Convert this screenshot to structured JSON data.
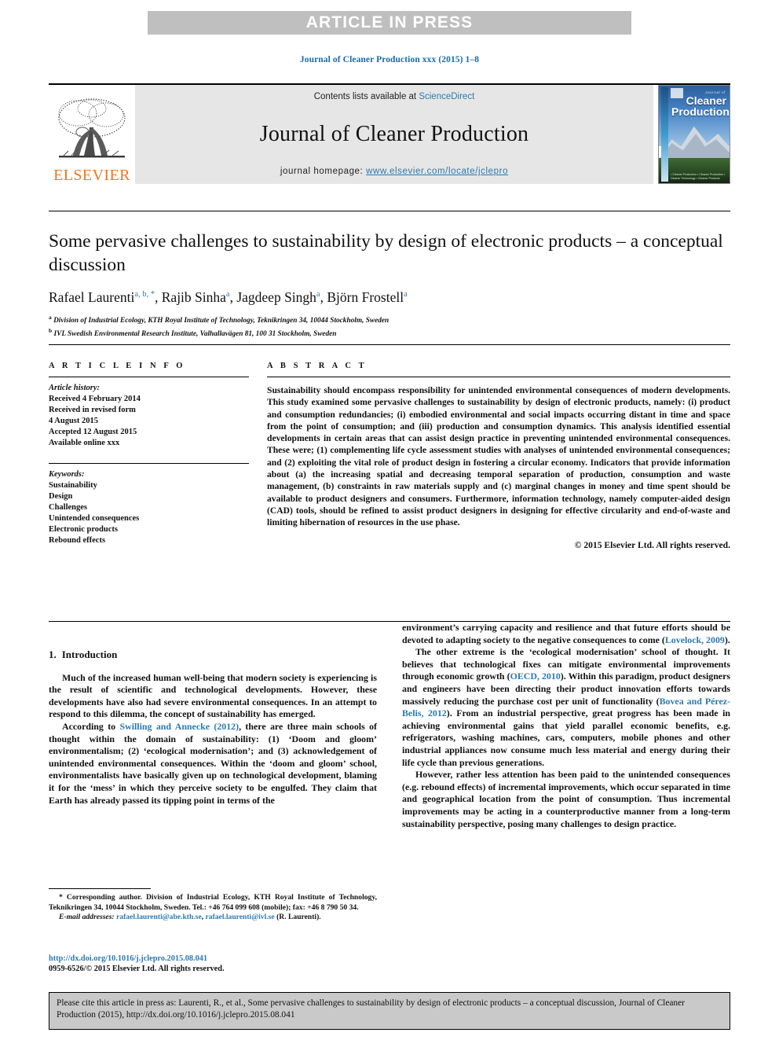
{
  "banner": {
    "text": "ARTICLE IN PRESS"
  },
  "running_head": "Journal of Cleaner Production xxx (2015) 1–8",
  "masthead": {
    "contents_prefix": "Contents lists available at ",
    "sciencedirect": "ScienceDirect",
    "journal_title": "Journal of Cleaner Production",
    "homepage_label": "journal homepage: ",
    "homepage_url": "www.elsevier.com/locate/jclepro",
    "publisher_name": "ELSEVIER",
    "publisher_logo_icon": "elsevier-tree-icon",
    "cover": {
      "line1": "Journal of",
      "line2": "Cleaner",
      "line3": "Production",
      "footer": "• Cleaner Production   • Cleaner Production\n• Cleaner Technology  • Cleaner Products"
    },
    "link_color": "#2a7ab0",
    "elsevier_orange": "#e87722"
  },
  "article": {
    "title": "Some pervasive challenges to sustainability by design of electronic products – a conceptual discussion",
    "authors": [
      {
        "name": "Rafael Laurenti",
        "marks": "a, b, *"
      },
      {
        "name": "Rajib Sinha",
        "marks": "a"
      },
      {
        "name": "Jagdeep Singh",
        "marks": "a"
      },
      {
        "name": "Björn Frostell",
        "marks": "a"
      }
    ],
    "affiliations": [
      {
        "mark": "a",
        "text": "Division of Industrial Ecology, KTH Royal Institute of Technology, Teknikringen 34, 10044 Stockholm, Sweden"
      },
      {
        "mark": "b",
        "text": "IVL Swedish Environmental Research Institute, Valhallavägen 81, 100 31 Stockholm, Sweden"
      }
    ]
  },
  "article_info": {
    "heading": "A R T I C L E  I N F O",
    "history_label": "Article history:",
    "history": [
      "Received 4 February 2014",
      "Received in revised form",
      "4 August 2015",
      "Accepted 12 August 2015",
      "Available online xxx"
    ],
    "keywords_label": "Keywords:",
    "keywords": [
      "Sustainability",
      "Design",
      "Challenges",
      "Unintended consequences",
      "Electronic products",
      "Rebound effects"
    ]
  },
  "abstract": {
    "heading": "A B S T R A C T",
    "text": "Sustainability should encompass responsibility for unintended environmental consequences of modern developments. This study examined some pervasive challenges to sustainability by design of electronic products, namely: (i) product and consumption redundancies; (i) embodied environmental and social impacts occurring distant in time and space from the point of consumption; and (iii) production and consumption dynamics. This analysis identified essential developments in certain areas that can assist design practice in preventing unintended environmental consequences. These were; (1) complementing life cycle assessment studies with analyses of unintended environmental consequences; and (2) exploiting the vital role of product design in fostering a circular economy. Indicators that provide information about (a) the increasing spatial and decreasing temporal separation of production, consumption and waste management, (b) constraints in raw materials supply and (c) marginal changes in money and time spent should be available to product designers and consumers. Furthermore, information technology, namely computer-aided design (CAD) tools, should be refined to assist product designers in designing for effective circularity and end-of-waste and limiting hibernation of resources in the use phase.",
    "copyright": "© 2015 Elsevier Ltd. All rights reserved."
  },
  "body": {
    "section_number": "1.",
    "section_title": "Introduction",
    "left_paragraphs": [
      "Much of the increased human well-being that modern society is experiencing is the result of scientific and technological developments. However, these developments have also had severe environmental consequences. In an attempt to respond to this dilemma, the concept of sustainability has emerged.",
      "According to Swilling and Annecke (2012), there are three main schools of thought within the domain of sustainability: (1) 'Doom and gloom' environmentalism; (2) 'ecological modernisation'; and (3) acknowledgement of unintended environmental consequences. Within the 'doom and gloom' school, environmentalists have basically given up on technological development, blaming it for the 'mess' in which they perceive society to be engulfed. They claim that Earth has already passed its tipping point in terms of the"
    ],
    "right_paragraphs": [
      "environment's carrying capacity and resilience and that future efforts should be devoted to adapting society to the negative consequences to come (Lovelock, 2009).",
      "The other extreme is the 'ecological modernisation' school of thought. It believes that technological fixes can mitigate environmental improvements through economic growth (OECD, 2010). Within this paradigm, product designers and engineers have been directing their product innovation efforts towards massively reducing the purchase cost per unit of functionality (Bovea and Pérez-Belis, 2012). From an industrial perspective, great progress has been made in achieving environmental gains that yield parallel economic benefits, e.g. refrigerators, washing machines, cars, computers, mobile phones and other industrial appliances now consume much less material and energy during their life cycle than previous generations.",
      "However, rather less attention has been paid to the unintended consequences (e.g. rebound effects) of incremental improvements, which occur separated in time and geographical location from the point of consumption. Thus incremental improvements may be acting in a counterproductive manner from a long-term sustainability perspective, posing many challenges to design practice."
    ],
    "references_inline": [
      "Swilling and Annecke (2012)",
      "Lovelock, 2009",
      "OECD, 2010",
      "Bovea and Pérez-Belis, 2012"
    ]
  },
  "footnote": {
    "corresponding": "* Corresponding author. Division of Industrial Ecology, KTH Royal Institute of Technology, Teknikringen 34, 10044 Stockholm, Sweden. Tel.: +46 764 099 608 (mobile); fax: +46 8 790 50 34.",
    "email_label": "E-mail addresses:",
    "emails": [
      "rafael.laurenti@abe.kth.se",
      "rafael.laurenti@ivl.se"
    ],
    "email_owner": "(R. Laurenti)."
  },
  "doi": {
    "url": "http://dx.doi.org/10.1016/j.jclepro.2015.08.041",
    "issn_line": "0959-6526/© 2015 Elsevier Ltd. All rights reserved."
  },
  "cite_box": {
    "text": "Please cite this article in press as: Laurenti, R., et al., Some pervasive challenges to sustainability by design of electronic products – a conceptual discussion, Journal of Cleaner Production (2015), http://dx.doi.org/10.1016/j.jclepro.2015.08.041"
  }
}
